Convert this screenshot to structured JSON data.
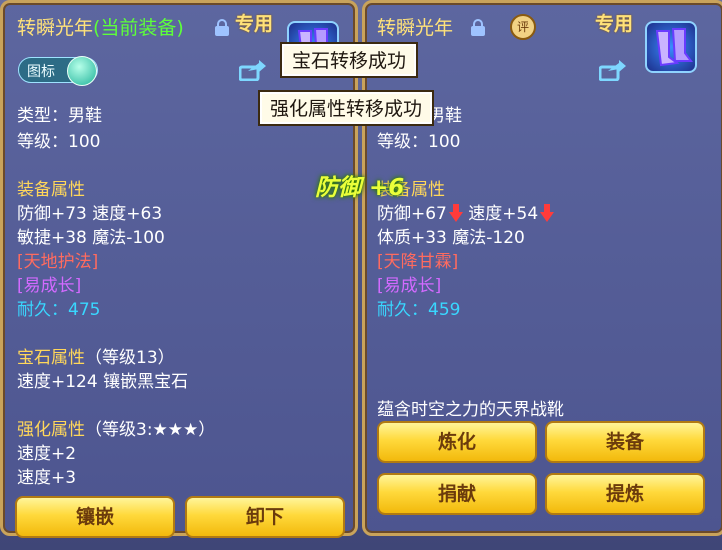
{
  "left_panel": {
    "title_name": "转瞬光年",
    "title_status": "(当前装备)",
    "special_label": "专用",
    "toggle_label": "图标",
    "lines": {
      "type": "类型：男鞋",
      "level": "等级：100",
      "equip_attr_header": "装备属性",
      "attr1": "防御+73 速度+63",
      "attr2": "敏捷+38 魔法-100",
      "skill": "[天地护法]",
      "growth": "[易成长]",
      "durability_label": "耐久：",
      "durability_value": "475",
      "gem_header": "宝石属性",
      "gem_level": "（等级13）",
      "gem_attr": "速度+124 镶嵌黑宝石",
      "enhance_header": "强化属性",
      "enhance_level": "（等级3:★★★）",
      "enhance1": "速度+2",
      "enhance2": "速度+3"
    },
    "buttons": {
      "inlay": "镶嵌",
      "remove": "卸下"
    }
  },
  "right_panel": {
    "title_name": "转瞬光年",
    "rating_badge": "评",
    "special_label": "专用",
    "lines": {
      "type": "类型：男鞋",
      "level": "等级：100",
      "equip_attr_header": "装备属性",
      "attr1a": "防御+67",
      "attr1b": "速度+54",
      "attr2": "体质+33 魔法-120",
      "skill": "[天降甘霖]",
      "growth": "[易成长]",
      "durability_label": "耐久：",
      "durability_value": "459",
      "description": "蕴含时空之力的天界战靴"
    },
    "buttons": {
      "refine": "炼化",
      "equip": "装备",
      "donate": "捐献",
      "extract": "提炼"
    }
  },
  "tooltips": {
    "gem_transfer": "宝石转移成功",
    "enhance_transfer": "强化属性转移成功"
  },
  "floating_text": "防御 +6",
  "colors": {
    "title_gold": "#ffe27a",
    "current_green": "#5dff3a",
    "skill_red": "#ff6b5f",
    "growth_purple": "#d36aff",
    "durability_cyan": "#39d7ff",
    "button_gold": "#ffd93b"
  }
}
